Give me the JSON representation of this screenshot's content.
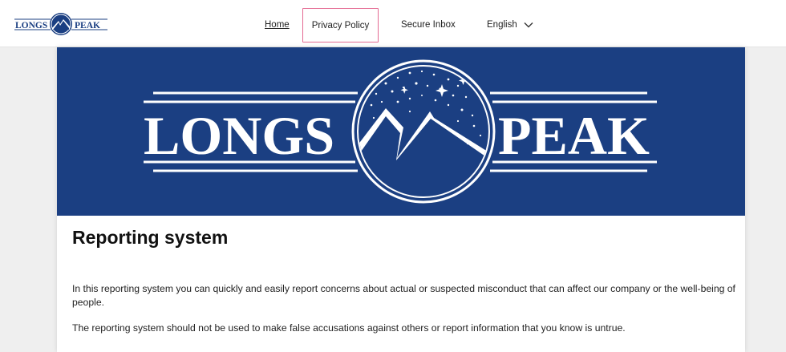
{
  "header": {
    "logo_text_left": "LONGS",
    "logo_text_right": "PEAK",
    "nav": {
      "home": "Home",
      "privacy": "Privacy Policy",
      "secure_inbox": "Secure Inbox",
      "language": "English"
    }
  },
  "hero": {
    "logo_text_left": "LONGS",
    "logo_text_right": "PEAK"
  },
  "main": {
    "title": "Reporting system",
    "paragraphs": [
      "In this reporting system you can quickly and easily report concerns about actual or suspected misconduct that can affect our company or the well-being of people.",
      "The reporting system should not be used to make false accusations against others or report information that you know is untrue."
    ]
  },
  "colors": {
    "brand_blue": "#1b3f82",
    "highlight_border": "#e46a92"
  },
  "icons": {
    "language_dropdown": "chevron-down-icon"
  }
}
